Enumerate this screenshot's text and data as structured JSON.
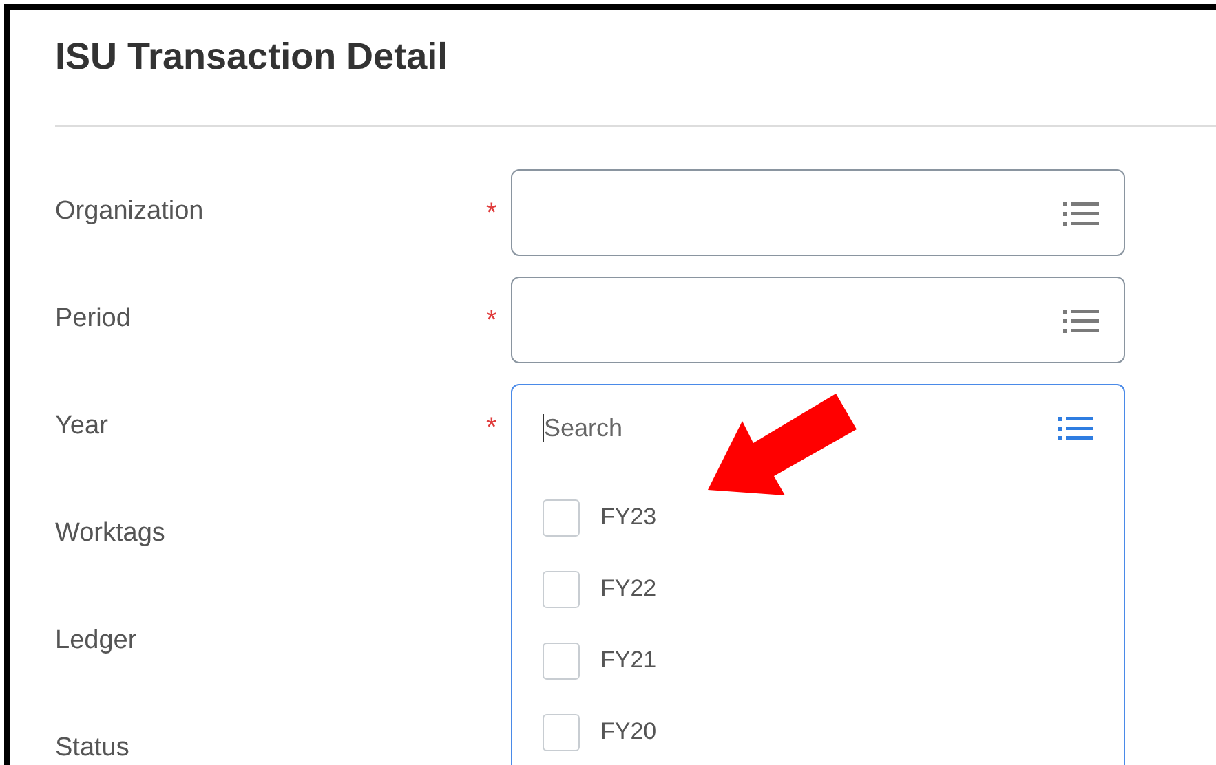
{
  "page": {
    "title": "ISU Transaction Detail"
  },
  "fields": [
    {
      "label": "Organization",
      "required_mark": "*",
      "kind": "prompt",
      "focused": false
    },
    {
      "label": "Period",
      "required_mark": "*",
      "kind": "prompt",
      "focused": false
    },
    {
      "label": "Year",
      "required_mark": "*",
      "kind": "prompt",
      "focused": true,
      "placeholder": "Search",
      "options": [
        {
          "label": "FY23",
          "checked": false
        },
        {
          "label": "FY22",
          "checked": false
        },
        {
          "label": "FY21",
          "checked": false
        },
        {
          "label": "FY20",
          "checked": false
        }
      ]
    },
    {
      "label": "Worktags",
      "kind": "hidden"
    },
    {
      "label": "Ledger",
      "kind": "hidden"
    },
    {
      "label": "Status",
      "kind": "hidden"
    }
  ]
}
